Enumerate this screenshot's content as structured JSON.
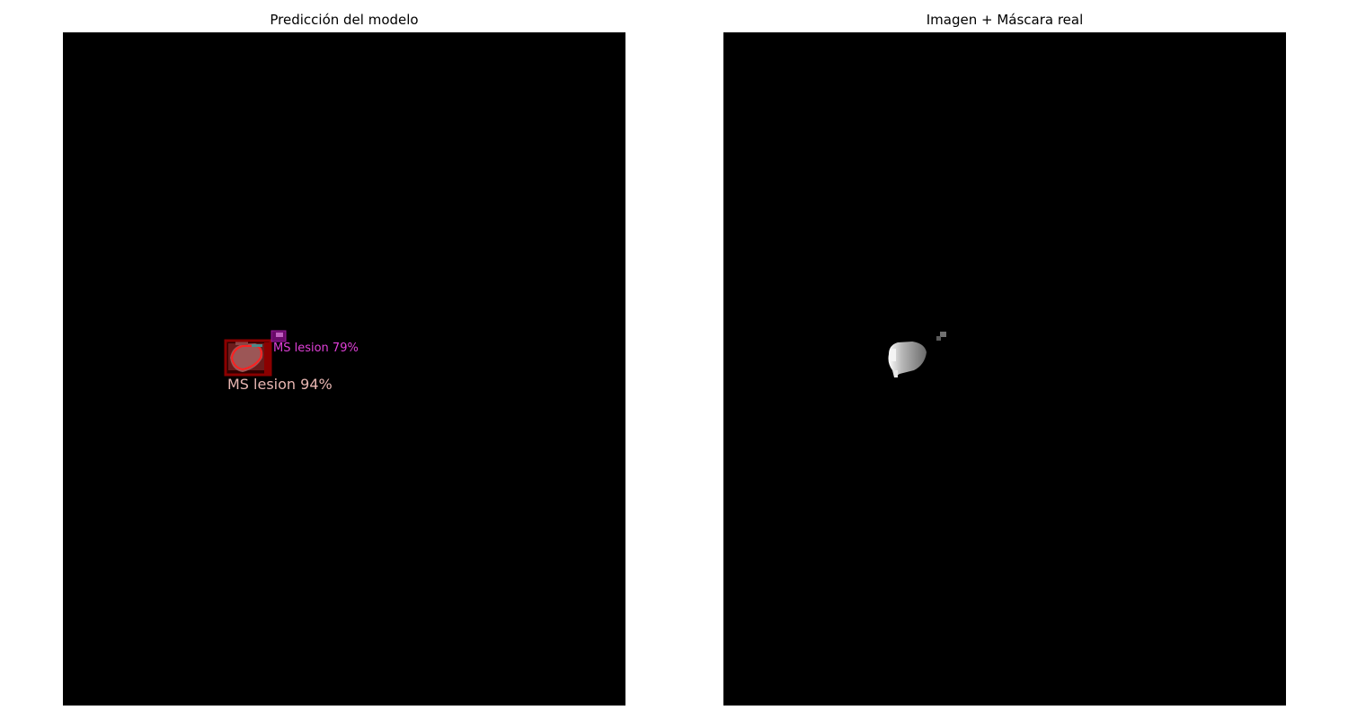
{
  "figure": {
    "background": "#ffffff",
    "panels": [
      {
        "title": "Predicción del modelo",
        "detections": [
          {
            "label": "MS lesion 94%",
            "color": "#e8b6b2",
            "box_color": "#8b0000",
            "contour_color": "#ff2020"
          },
          {
            "label": "MS lesion 79%",
            "color": "#e040d8",
            "box_color": "#7a0a7a"
          }
        ]
      },
      {
        "title": "Imagen + Máscara real"
      }
    ]
  }
}
